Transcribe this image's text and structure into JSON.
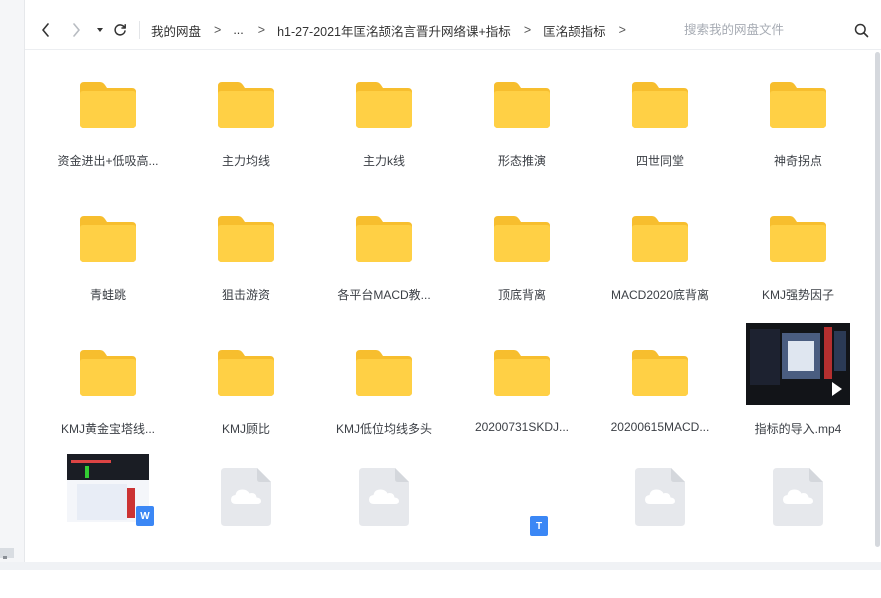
{
  "toolbar": {
    "back": "back",
    "forward": "forward",
    "dropdown": "history-dropdown",
    "refresh": "refresh"
  },
  "breadcrumb": {
    "items": [
      "我的网盘",
      "...",
      "h1-27-2021年匡洺颉洺言晋升网络课+指标",
      "匡洺颉指标"
    ],
    "separator": ">"
  },
  "search": {
    "placeholder": "搜索我的网盘文件",
    "value": ""
  },
  "files": [
    {
      "name": "资金进出+低吸高...",
      "type": "folder"
    },
    {
      "name": "主力均线",
      "type": "folder"
    },
    {
      "name": "主力k线",
      "type": "folder"
    },
    {
      "name": "形态推演",
      "type": "folder"
    },
    {
      "name": "四世同堂",
      "type": "folder"
    },
    {
      "name": "神奇拐点",
      "type": "folder"
    },
    {
      "name": "青蛙跳",
      "type": "folder"
    },
    {
      "name": "狙击游资",
      "type": "folder"
    },
    {
      "name": "各平台MACD教...",
      "type": "folder"
    },
    {
      "name": "顶底背离",
      "type": "folder"
    },
    {
      "name": "MACD2020底背离",
      "type": "folder"
    },
    {
      "name": "KMJ强势因子",
      "type": "folder"
    },
    {
      "name": "KMJ黄金宝塔线...",
      "type": "folder"
    },
    {
      "name": "KMJ顾比",
      "type": "folder"
    },
    {
      "name": "KMJ低位均线多头",
      "type": "folder"
    },
    {
      "name": "20200731SKDJ...",
      "type": "folder"
    },
    {
      "name": "20200615MACD...",
      "type": "folder"
    },
    {
      "name": "指标的导入.mp4",
      "type": "video"
    },
    {
      "name": "",
      "type": "doc-w"
    },
    {
      "name": "",
      "type": "cloud"
    },
    {
      "name": "",
      "type": "cloud"
    },
    {
      "name": "",
      "type": "txt"
    },
    {
      "name": "",
      "type": "cloud"
    },
    {
      "name": "",
      "type": "cloud"
    }
  ],
  "colors": {
    "folder": "#FFD045",
    "folder_back": "#F7BE2E",
    "cloud_file": "#E6E8EC",
    "badge": "#3B87F5"
  }
}
